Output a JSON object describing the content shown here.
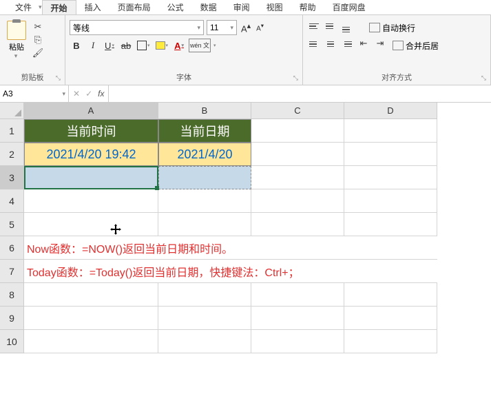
{
  "tabs": {
    "t1": "文件",
    "t2": "开始",
    "t3": "插入",
    "t4": "页面布局",
    "t5": "公式",
    "t6": "数据",
    "t7": "审阅",
    "t8": "视图",
    "t9": "帮助",
    "t10": "百度网盘"
  },
  "clipboard": {
    "paste": "粘贴",
    "group": "剪贴板"
  },
  "font": {
    "name": "等线",
    "size": "11",
    "group": "字体",
    "bold": "B",
    "italic": "I",
    "underline": "U",
    "strike": "ab",
    "colorA": "A",
    "wen": "wén\n文"
  },
  "align": {
    "group": "对齐方式",
    "wrap": "自动换行",
    "merge": "合并后居"
  },
  "fbar": {
    "name": "A3",
    "fx": "fx"
  },
  "cols": {
    "a": "A",
    "b": "B",
    "c": "C",
    "d": "D"
  },
  "rows": {
    "r1": "1",
    "r2": "2",
    "r3": "3",
    "r4": "4",
    "r5": "5",
    "r6": "6",
    "r7": "7",
    "r8": "8",
    "r9": "9",
    "r10": "10"
  },
  "cells": {
    "a1": "当前时间",
    "b1": "当前日期",
    "a2": "2021/4/20 19:42",
    "b2": "2021/4/20",
    "a6": "Now函数：=NOW()返回当前日期和时间。",
    "a7": "Today函数：=Today()返回当前日期，快捷键法：Ctrl+；"
  }
}
